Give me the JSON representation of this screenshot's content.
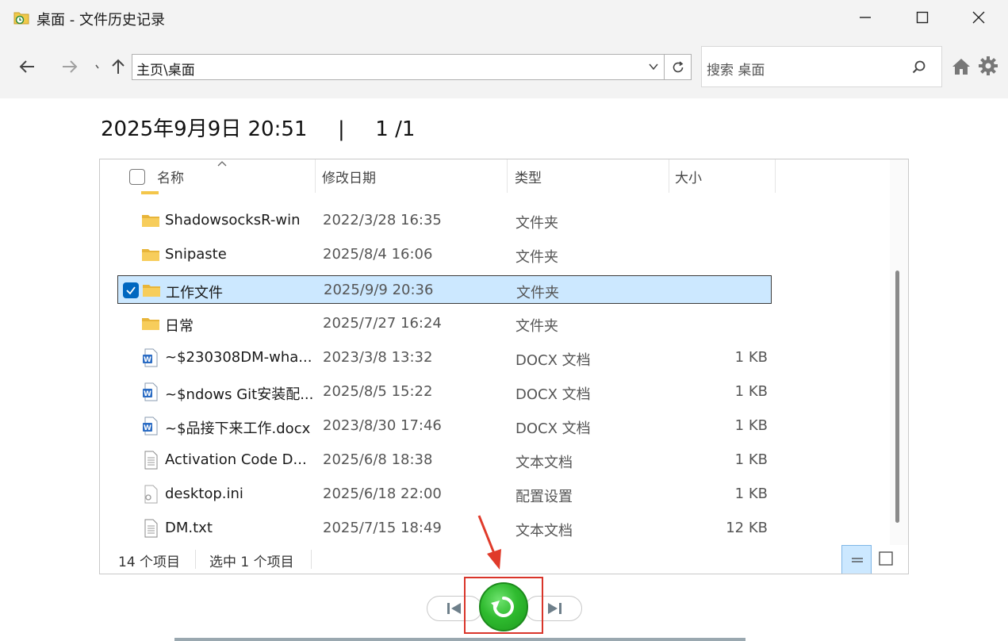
{
  "window": {
    "title": "桌面 - 文件历史记录",
    "icon": "folder-history-icon"
  },
  "nav": {
    "address": "主页\\桌面",
    "search_placeholder": "搜索 桌面"
  },
  "snapshot": {
    "datetime": "2025年9月9日 20:51",
    "separator": "|",
    "page": "1 /1"
  },
  "columns": {
    "name": "名称",
    "date": "修改日期",
    "type": "类型",
    "size": "大小"
  },
  "files": [
    {
      "name": "ShadowsocksR-win",
      "date": "2022/3/28 16:35",
      "type": "文件夹",
      "size": "",
      "icon": "folder-icon",
      "selected": false
    },
    {
      "name": "Snipaste",
      "date": "2025/8/4 16:06",
      "type": "文件夹",
      "size": "",
      "icon": "folder-icon",
      "selected": false
    },
    {
      "name": "工作文件",
      "date": "2025/9/9 20:36",
      "type": "文件夹",
      "size": "",
      "icon": "folder-icon",
      "selected": true
    },
    {
      "name": "日常",
      "date": "2025/7/27 16:24",
      "type": "文件夹",
      "size": "",
      "icon": "folder-icon",
      "selected": false
    },
    {
      "name": "~$230308DM-wha...",
      "date": "2023/3/8 13:32",
      "type": "DOCX 文档",
      "size": "1 KB",
      "icon": "word-doc-icon",
      "selected": false
    },
    {
      "name": "~$ndows Git安装配...",
      "date": "2025/8/5 15:22",
      "type": "DOCX 文档",
      "size": "1 KB",
      "icon": "word-doc-icon",
      "selected": false
    },
    {
      "name": "~$品接下来工作.docx",
      "date": "2023/8/30 17:46",
      "type": "DOCX 文档",
      "size": "1 KB",
      "icon": "word-doc-icon",
      "selected": false
    },
    {
      "name": "Activation Code D...",
      "date": "2025/6/8 18:38",
      "type": "文本文档",
      "size": "1 KB",
      "icon": "text-file-icon",
      "selected": false
    },
    {
      "name": "desktop.ini",
      "date": "2025/6/18 22:00",
      "type": "配置设置",
      "size": "1 KB",
      "icon": "settings-file-icon",
      "selected": false
    },
    {
      "name": "DM.txt",
      "date": "2025/7/15 18:49",
      "type": "文本文档",
      "size": "12 KB",
      "icon": "text-file-icon",
      "selected": false
    }
  ],
  "status": {
    "count": "14 个项目",
    "selected": "选中 1 个项目"
  },
  "colors": {
    "selection_bg": "#cce8ff",
    "checkbox_blue": "#0067c0",
    "restore_green": "#2fbb2f",
    "annotation_red": "#d9352a"
  }
}
